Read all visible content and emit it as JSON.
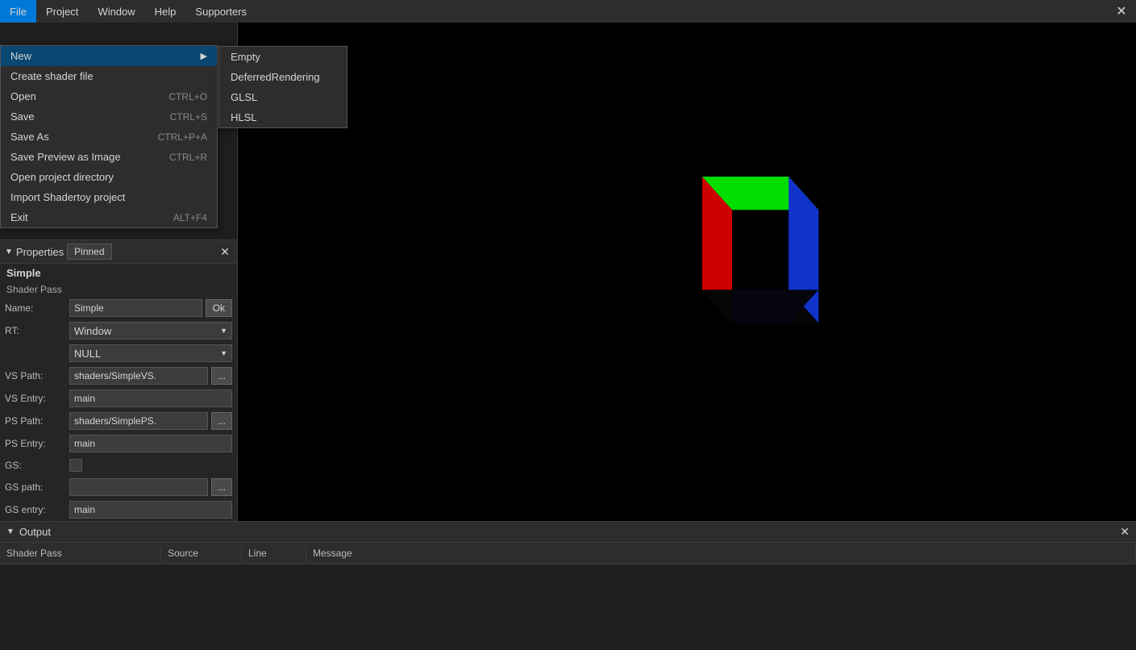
{
  "menubar": {
    "items": [
      {
        "label": "File",
        "id": "file"
      },
      {
        "label": "Project",
        "id": "project"
      },
      {
        "label": "Window",
        "id": "window"
      },
      {
        "label": "Help",
        "id": "help"
      },
      {
        "label": "Supporters",
        "id": "supporters"
      }
    ]
  },
  "file_menu": {
    "items": [
      {
        "label": "New",
        "shortcut": "",
        "hasSubmenu": true,
        "id": "new"
      },
      {
        "label": "Create shader file",
        "shortcut": "",
        "id": "create-shader"
      },
      {
        "label": "Open",
        "shortcut": "CTRL+O",
        "id": "open"
      },
      {
        "label": "Save",
        "shortcut": "CTRL+S",
        "id": "save"
      },
      {
        "label": "Save As",
        "shortcut": "CTRL+P+A",
        "id": "save-as"
      },
      {
        "label": "Save Preview as Image",
        "shortcut": "CTRL+R",
        "id": "save-preview"
      },
      {
        "label": "Open project directory",
        "shortcut": "",
        "id": "open-project-dir"
      },
      {
        "label": "Import Shadertoy project",
        "shortcut": "",
        "id": "import-shadertoy"
      },
      {
        "label": "Exit",
        "shortcut": "ALT+F4",
        "id": "exit"
      }
    ]
  },
  "new_submenu": {
    "items": [
      {
        "label": "Empty",
        "id": "empty"
      },
      {
        "label": "DeferredRendering",
        "id": "deferred"
      },
      {
        "label": "GLSL",
        "id": "glsl"
      },
      {
        "label": "HLSL",
        "id": "hlsl"
      }
    ]
  },
  "properties": {
    "panel_title": "Properties",
    "pinned_label": "Pinned",
    "section_title": "Simple",
    "subsection_title": "Shader Pass",
    "fields": {
      "name_label": "Name:",
      "name_value": "Simple",
      "name_ok": "Ok",
      "rt_label": "RT:",
      "rt_value": "Window",
      "rt2_value": "NULL",
      "vs_path_label": "VS Path:",
      "vs_path_value": "shaders/SimpleVS.",
      "vs_entry_label": "VS Entry:",
      "vs_entry_value": "main",
      "ps_path_label": "PS Path:",
      "ps_path_value": "shaders/SimplePS.",
      "ps_entry_label": "PS Entry:",
      "ps_entry_value": "main",
      "gs_label": "GS:",
      "gs_path_label": "GS path:",
      "gs_entry_label": "GS entry:",
      "gs_entry_value": "main"
    }
  },
  "output": {
    "title": "Output",
    "columns": [
      {
        "label": "Shader Pass",
        "id": "shader-pass"
      },
      {
        "label": "Source",
        "id": "source"
      },
      {
        "label": "Line",
        "id": "line"
      },
      {
        "label": "Message",
        "id": "message"
      }
    ]
  },
  "icons": {
    "close": "✕",
    "triangle_down": "▼",
    "triangle_right": "▶",
    "triangle_left": "◀",
    "ellipsis": "…"
  }
}
